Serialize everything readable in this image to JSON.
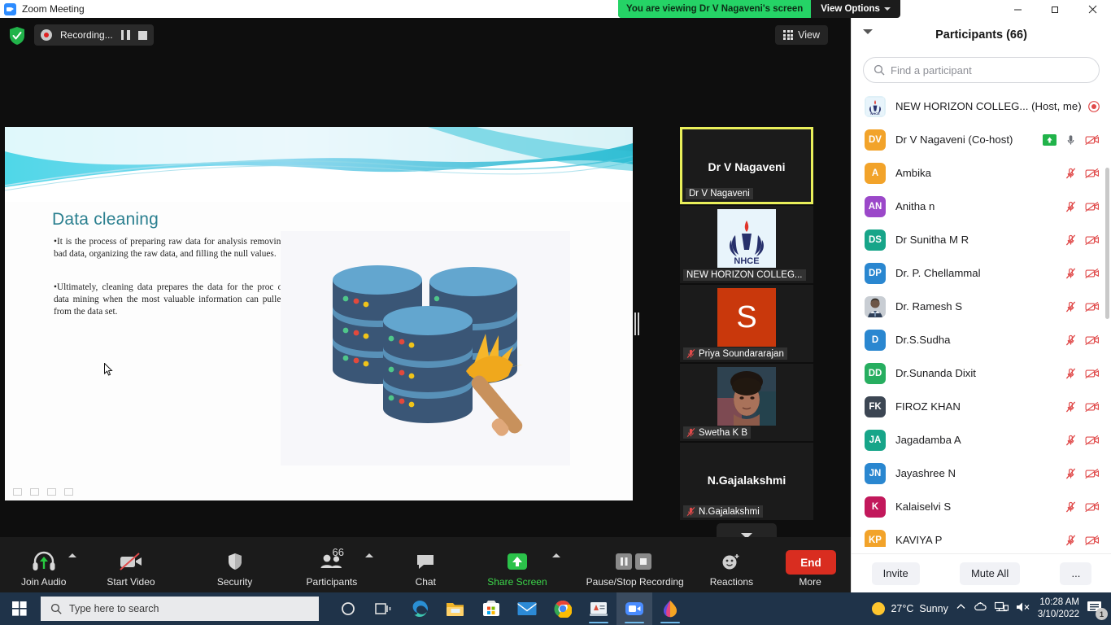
{
  "window": {
    "title": "Zoom Meeting",
    "app_icon": "zoom-camera-icon",
    "minimize": "—",
    "maximize": "❐",
    "close": "✕"
  },
  "view_banner": {
    "text": "You are viewing Dr V Nagaveni's screen",
    "options_label": "View Options",
    "green": "#25d366"
  },
  "recording": {
    "status_label": "Recording...",
    "pause_icon": "pause-icon",
    "stop_icon": "stop-icon",
    "shield_icon": "security-shield-icon"
  },
  "view_button": {
    "label": "View",
    "icon": "grid-icon"
  },
  "slide": {
    "title": "Data cleaning",
    "paragraph1": "•It is the process of preparing raw data for analysis removing bad data, organizing the raw data, and filling the null values.",
    "paragraph2": "•Ultimately, cleaning data prepares the data for the proc of data mining when the most valuable information can pulled from the data set.",
    "image_alt": "database-cleaning-illustration",
    "title_color": "#2a7f8f"
  },
  "thumbnails": [
    {
      "name": "Dr V Nagaveni",
      "label": "Dr V Nagaveni",
      "type": "name-only",
      "active": true,
      "muted": false
    },
    {
      "name": "NEW HORIZON COLLEG...",
      "label": "NEW HORIZON COLLEG...",
      "type": "logo",
      "active": false,
      "muted": false
    },
    {
      "name": "Priya Soundararajan",
      "label": "Priya Soundararajan",
      "type": "initial",
      "initial": "S",
      "color": "#c9380c",
      "active": false,
      "muted": true
    },
    {
      "name": "Swetha K B",
      "label": "Swetha K B",
      "type": "photo",
      "active": false,
      "muted": true
    },
    {
      "name": "N.Gajalakshmi",
      "label": "N.Gajalakshmi",
      "type": "name-only",
      "active": false,
      "muted": true
    }
  ],
  "strip_more_icon": "chevron-down-icon",
  "toolbar": {
    "buttons": [
      {
        "label": "Join Audio",
        "icon": "headset-icon",
        "caret": true,
        "green": false
      },
      {
        "label": "Start Video",
        "icon": "video-off-icon",
        "caret": false,
        "green": false
      },
      {
        "label": "Security",
        "icon": "shield-icon",
        "caret": false,
        "green": false
      },
      {
        "label": "Participants",
        "icon": "participants-icon",
        "caret": true,
        "green": false,
        "count": "66"
      },
      {
        "label": "Chat",
        "icon": "chat-icon",
        "caret": false,
        "green": false
      },
      {
        "label": "Share Screen",
        "icon": "share-screen-icon",
        "caret": true,
        "green": true
      },
      {
        "label": "Pause/Stop Recording",
        "icon": "pause-stop-icon",
        "caret": false,
        "green": false
      },
      {
        "label": "Reactions",
        "icon": "reactions-icon",
        "caret": false,
        "green": false
      },
      {
        "label": "More",
        "icon": "more-dots-icon",
        "caret": false,
        "green": false
      }
    ],
    "end_label": "End"
  },
  "participants_panel": {
    "title": "Participants (66)",
    "search_placeholder": "Find a participant",
    "search_value": "",
    "search_icon": "search-icon",
    "collapse_icon": "chevron-down-icon",
    "list": [
      {
        "name": "NEW HORIZON COLLEG...",
        "suffix": "(Host, me)",
        "avatar_type": "logo",
        "initials": "",
        "color": "#dff0f7",
        "mic": "record-dot",
        "video": "none"
      },
      {
        "name": "Dr V Nagaveni (Co-host)",
        "suffix": "",
        "avatar_type": "initials",
        "initials": "DV",
        "color": "#f2a32a",
        "mic": "mic-on",
        "video": "video-off",
        "sharing": true
      },
      {
        "name": "Ambika",
        "suffix": "",
        "avatar_type": "initials",
        "initials": "A",
        "color": "#f2a32a",
        "mic": "mic-off",
        "video": "video-off"
      },
      {
        "name": "Anitha n",
        "suffix": "",
        "avatar_type": "initials",
        "initials": "AN",
        "color": "#9b48c9",
        "mic": "mic-off",
        "video": "video-off"
      },
      {
        "name": "Dr Sunitha M R",
        "suffix": "",
        "avatar_type": "initials",
        "initials": "DS",
        "color": "#17a589",
        "mic": "mic-off",
        "video": "video-off"
      },
      {
        "name": "Dr. P. Chellammal",
        "suffix": "",
        "avatar_type": "initials",
        "initials": "DP",
        "color": "#2a87d0",
        "mic": "mic-off",
        "video": "video-off"
      },
      {
        "name": "Dr. Ramesh S",
        "suffix": "",
        "avatar_type": "photo",
        "initials": "",
        "color": "#7a6a5a",
        "mic": "mic-off",
        "video": "video-off"
      },
      {
        "name": "Dr.S.Sudha",
        "suffix": "",
        "avatar_type": "initials",
        "initials": "D",
        "color": "#2a87d0",
        "mic": "mic-off",
        "video": "video-off"
      },
      {
        "name": "Dr.Sunanda Dixit",
        "suffix": "",
        "avatar_type": "initials",
        "initials": "DD",
        "color": "#27ae60",
        "mic": "mic-off",
        "video": "video-off"
      },
      {
        "name": "FIROZ KHAN",
        "suffix": "",
        "avatar_type": "initials",
        "initials": "FK",
        "color": "#3c4653",
        "mic": "mic-off",
        "video": "video-off"
      },
      {
        "name": "Jagadamba A",
        "suffix": "",
        "avatar_type": "initials",
        "initials": "JA",
        "color": "#17a589",
        "mic": "mic-off",
        "video": "video-off"
      },
      {
        "name": "Jayashree N",
        "suffix": "",
        "avatar_type": "initials",
        "initials": "JN",
        "color": "#2a87d0",
        "mic": "mic-off",
        "video": "video-off"
      },
      {
        "name": "Kalaiselvi S",
        "suffix": "",
        "avatar_type": "initials",
        "initials": "K",
        "color": "#c2185b",
        "mic": "mic-off",
        "video": "video-off"
      },
      {
        "name": "KAVIYA P",
        "suffix": "",
        "avatar_type": "initials",
        "initials": "KP",
        "color": "#f2a32a",
        "mic": "mic-off",
        "video": "video-off"
      }
    ],
    "footer": {
      "invite": "Invite",
      "mute_all": "Mute All",
      "more": "..."
    }
  },
  "taskbar": {
    "start_icon": "windows-logo-icon",
    "search_placeholder": "Type here to search",
    "search_icon": "search-icon",
    "icons": [
      "cortana-icon",
      "task-view-icon",
      "edge-icon",
      "file-explorer-icon",
      "microsoft-store-icon",
      "mail-icon",
      "chrome-icon",
      "document-icon",
      "zoom-icon",
      "paint-icon"
    ],
    "weather_temp": "27°C",
    "weather_cond": "Sunny",
    "time": "10:28 AM",
    "date": "3/10/2022",
    "notification_count": "1",
    "tray_icons": [
      "chevron-up-icon",
      "onedrive-icon",
      "network-icon",
      "volume-muted-icon"
    ]
  }
}
